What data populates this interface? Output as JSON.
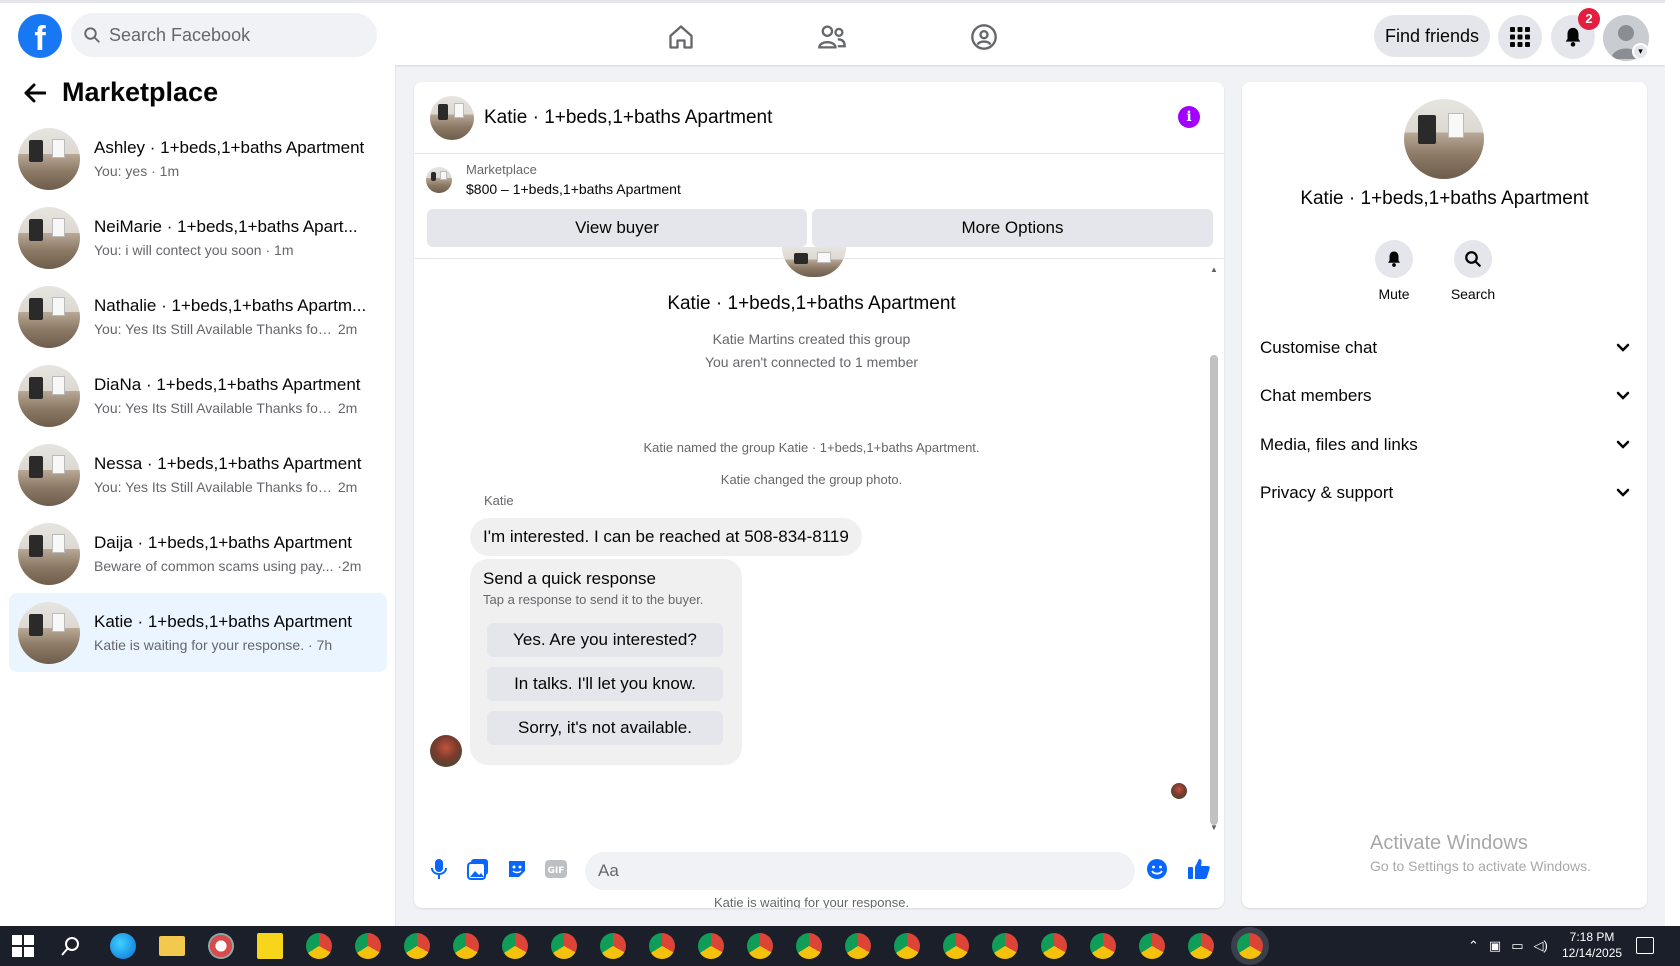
{
  "header": {
    "search_placeholder": "Search Facebook",
    "find_friends_label": "Find friends",
    "notification_count": "2",
    "nav_icons": [
      "home-icon",
      "friends-icon",
      "groups-icon"
    ]
  },
  "sidebar": {
    "title": "Marketplace",
    "conversations": [
      {
        "title": "Ashley · 1+beds,1+baths Apartment",
        "snippet": "You: yes",
        "time": "1m"
      },
      {
        "title": "NeiMarie · 1+beds,1+baths Apart...",
        "snippet": "You: i will contect you soon",
        "time": "1m"
      },
      {
        "title": "Nathalie · 1+beds,1+baths Apartm...",
        "snippet": "You: Yes Its Still Available Thanks for y...",
        "time": "2m"
      },
      {
        "title": "DiaNa · 1+beds,1+baths Apartment",
        "snippet": "You: Yes Its Still Available Thanks for y...",
        "time": "2m"
      },
      {
        "title": "Nessa · 1+beds,1+baths Apartment",
        "snippet": "You: Yes Its Still Available Thanks for y...",
        "time": "2m"
      },
      {
        "title": "Daija · 1+beds,1+baths Apartment",
        "snippet": "Beware of common scams using pay...",
        "time": "2m"
      },
      {
        "title": "Katie · 1+beds,1+baths Apartment",
        "snippet": "Katie is waiting for your response.",
        "time": "7h"
      }
    ]
  },
  "chat": {
    "title": "Katie · 1+beds,1+baths Apartment",
    "listing_source": "Marketplace",
    "listing_price": "$800 – 1+beds,1+baths Apartment",
    "view_buyer_label": "View buyer",
    "more_options_label": "More Options",
    "group_title": "Katie · 1+beds,1+baths Apartment",
    "created_line": "Katie Martins created this group",
    "connected_line": "You aren't connected to 1 member",
    "named_line": "Katie named the group Katie · 1+beds,1+baths Apartment.",
    "photo_line": "Katie changed the group photo.",
    "sender_name": "Katie",
    "message": "I'm interested. I can be reached at 508-834-8119",
    "quick_title": "Send a quick response",
    "quick_sub": "Tap a response to send it to the buyer.",
    "quick_responses": [
      "Yes. Are you interested?",
      "In talks. I'll let you know.",
      "Sorry, it's not available."
    ],
    "waiting_line": "Katie is waiting for your response.",
    "composer_placeholder": "Aa"
  },
  "details": {
    "title": "Katie · 1+beds,1+baths Apartment",
    "mute_label": "Mute",
    "search_label": "Search",
    "sections": [
      "Customise chat",
      "Chat members",
      "Media, files and links",
      "Privacy & support"
    ]
  },
  "watermark": {
    "line1": "Activate Windows",
    "line2": "Go to Settings to activate Windows."
  },
  "taskbar": {
    "time": "7:18 PM",
    "date": "12/14/2025"
  },
  "colors": {
    "facebook_blue": "#1877f2",
    "active_conversation": "#ebf5ff",
    "info_purple": "#a100ff",
    "badge_red": "#e41e3f"
  }
}
